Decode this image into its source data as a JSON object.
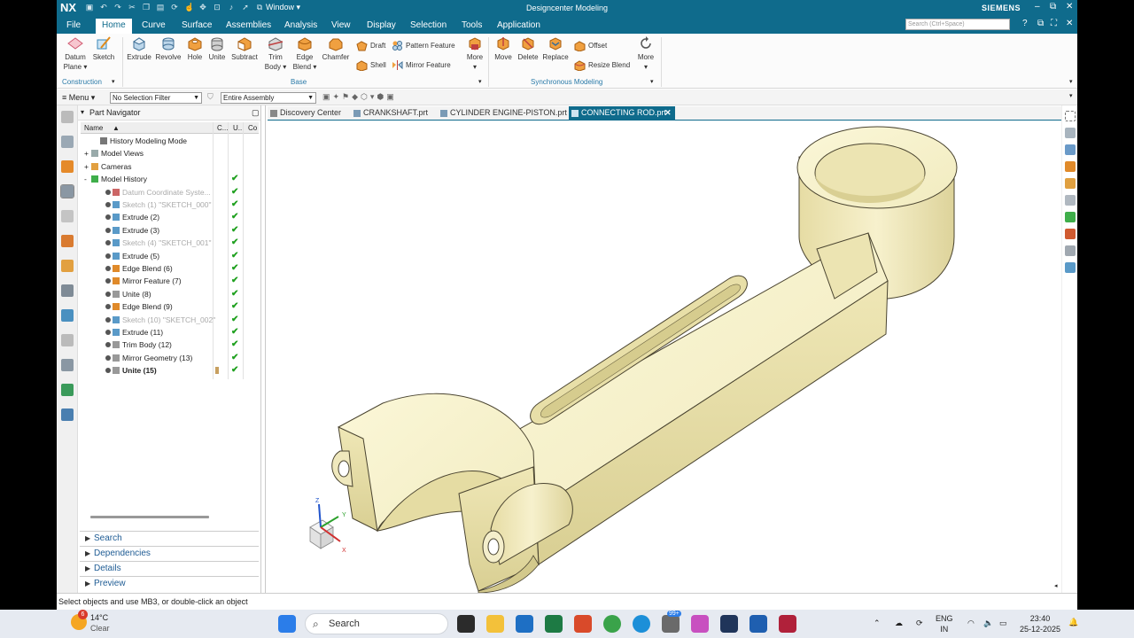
{
  "app": {
    "logo": "NX",
    "window_menu": "Window ▾",
    "title": "Designcenter Modeling",
    "brand": "SIEMENS"
  },
  "menu": {
    "tabs": [
      "File",
      "Home",
      "Curve",
      "Surface",
      "Assemblies",
      "Analysis",
      "View",
      "Display",
      "Selection",
      "Tools",
      "Application"
    ],
    "active_tab": "Home",
    "search_placeholder": "Search (Ctrl+Space)"
  },
  "ribbon": {
    "construction": {
      "datum_plane": "Datum",
      "datum_plane2": "Plane ▾",
      "sketch": "Sketch",
      "group_label": "Construction"
    },
    "base": {
      "extrude": "Extrude",
      "revolve": "Revolve",
      "hole": "Hole",
      "unite": "Unite",
      "subtract": "Subtract",
      "trim_body": "Trim",
      "trim_body2": "Body ▾",
      "edge_blend": "Edge",
      "edge_blend2": "Blend ▾",
      "chamfer": "Chamfer",
      "draft": "Draft",
      "shell": "Shell",
      "pattern_feature": "Pattern Feature",
      "mirror_feature": "Mirror Feature",
      "more": "More",
      "group_label": "Base"
    },
    "sync": {
      "move": "Move",
      "delete": "Delete",
      "replace": "Replace",
      "offset": "Offset",
      "resize_blend": "Resize Blend",
      "more": "More",
      "group_label": "Synchronous Modeling"
    }
  },
  "selection_bar": {
    "menu": "Menu ▾",
    "filter": "No Selection Filter",
    "scope": "Entire Assembly"
  },
  "navigator": {
    "title": "Part Navigator",
    "columns": {
      "name": "Name",
      "c": "C...",
      "u": "U...",
      "co": "Co"
    },
    "rows": [
      {
        "label": "History Modeling Mode",
        "state": "normal",
        "check": ""
      },
      {
        "label": "Model Views",
        "state": "normal",
        "check": ""
      },
      {
        "label": "Cameras",
        "state": "normal",
        "check": ""
      },
      {
        "label": "Model History",
        "state": "normal",
        "check": "✔"
      },
      {
        "label": "Datum Coordinate Syste...",
        "state": "dim",
        "check": "✔"
      },
      {
        "label": "Sketch (1) \"SKETCH_000\"",
        "state": "dim",
        "check": "✔"
      },
      {
        "label": "Extrude (2)",
        "state": "normal",
        "check": "✔"
      },
      {
        "label": "Extrude (3)",
        "state": "normal",
        "check": "✔"
      },
      {
        "label": "Sketch (4) \"SKETCH_001\"",
        "state": "dim",
        "check": "✔"
      },
      {
        "label": "Extrude (5)",
        "state": "normal",
        "check": "✔"
      },
      {
        "label": "Edge Blend (6)",
        "state": "normal",
        "check": "✔"
      },
      {
        "label": "Mirror Feature (7)",
        "state": "normal",
        "check": "✔"
      },
      {
        "label": "Unite (8)",
        "state": "normal",
        "check": "✔"
      },
      {
        "label": "Edge Blend (9)",
        "state": "normal",
        "check": "✔"
      },
      {
        "label": "Sketch (10) \"SKETCH_002\"",
        "state": "dim",
        "check": "✔"
      },
      {
        "label": "Extrude (11)",
        "state": "normal",
        "check": "✔"
      },
      {
        "label": "Trim Body (12)",
        "state": "normal",
        "check": "✔"
      },
      {
        "label": "Mirror Geometry (13)",
        "state": "normal",
        "check": "✔"
      },
      {
        "label": "Unite (15)",
        "state": "bold",
        "check": "✔"
      }
    ],
    "sections": [
      "Search",
      "Dependencies",
      "Details",
      "Preview"
    ]
  },
  "doc_tabs": [
    {
      "label": "Discovery Center",
      "active": false
    },
    {
      "label": "CRANKSHAFT.prt",
      "active": false
    },
    {
      "label": "CYLINDER ENGINE-PISTON.prt",
      "active": false
    },
    {
      "label": "CONNECTING ROD.prt",
      "active": true
    }
  ],
  "triad": {
    "x": "X",
    "y": "Y",
    "z": "Z"
  },
  "status_text": "Select objects and use MB3, or double-click an object",
  "taskbar": {
    "weather_badge": "6",
    "temperature": "14°C",
    "condition": "Clear",
    "search": "Search",
    "notif_badge": "99+",
    "lang1": "ENG",
    "lang2": "IN",
    "time": "23:40",
    "date": "25-12-2025"
  },
  "colors": {
    "title_bar": "#0f6b8c",
    "part_fill": "#f3eec2",
    "accent_link": "#1f5c94",
    "check_green": "#1ea01e"
  }
}
